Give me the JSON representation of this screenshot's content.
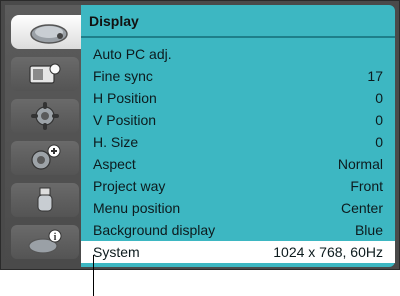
{
  "menu": {
    "title": "Display",
    "items": [
      {
        "label": "Auto PC adj.",
        "value": ""
      },
      {
        "label": "Fine sync",
        "value": "17"
      },
      {
        "label": "H Position",
        "value": "0"
      },
      {
        "label": "V Position",
        "value": "0"
      },
      {
        "label": "H. Size",
        "value": "0"
      },
      {
        "label": "Aspect",
        "value": "Normal"
      },
      {
        "label": "Project way",
        "value": "Front"
      },
      {
        "label": "Menu position",
        "value": "Center"
      },
      {
        "label": "Background display",
        "value": "Blue"
      },
      {
        "label": "System",
        "value": "1024 x 768, 60Hz"
      }
    ],
    "selected_index": 9
  },
  "sidebar": {
    "icons": [
      "display-icon",
      "picture-icon",
      "gear-icon",
      "gear-plus-icon",
      "usb-icon",
      "info-icon"
    ],
    "active_index": 0
  },
  "colors": {
    "panel": "#3db7c2",
    "frame": "#4a4a4a",
    "selected_row": "#ffffff"
  }
}
